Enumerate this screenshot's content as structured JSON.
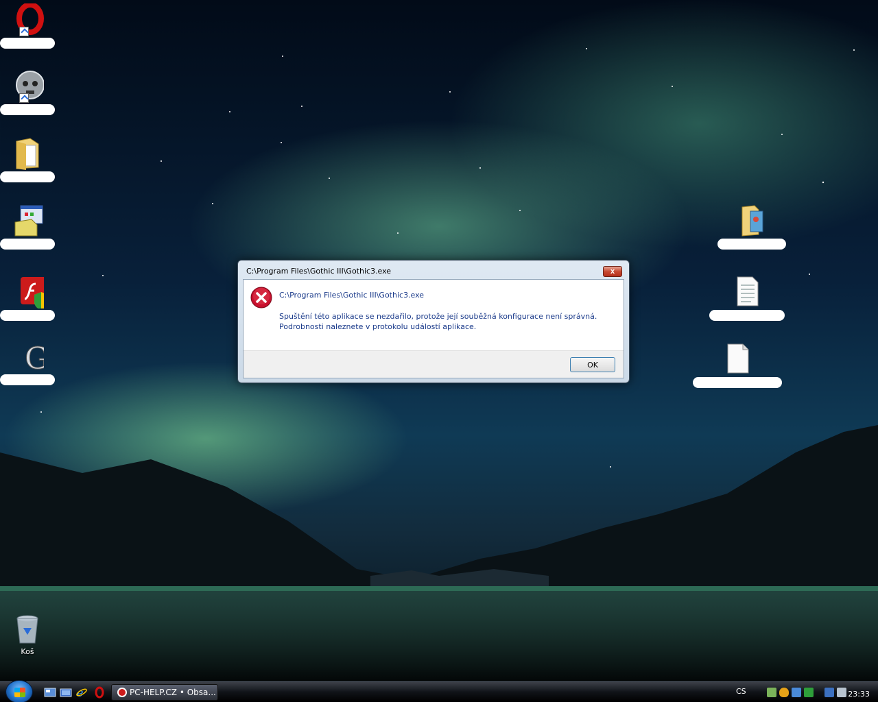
{
  "desktop": {
    "left_icons": [
      {
        "name": "opera-shortcut-icon",
        "label": ""
      },
      {
        "name": "skull-shortcut-icon",
        "label": ""
      },
      {
        "name": "folder-icon",
        "label": ""
      },
      {
        "name": "setup-program-icon",
        "label": ""
      },
      {
        "name": "flash-installer-icon",
        "label": ""
      },
      {
        "name": "gothic-game-icon",
        "label": ""
      }
    ],
    "recycle_bin": {
      "label": "Koš"
    },
    "right_icons": [
      {
        "name": "pictures-folder-icon",
        "label": ""
      },
      {
        "name": "text-document-icon",
        "label": ""
      },
      {
        "name": "blank-file-icon",
        "label": ""
      }
    ]
  },
  "dialog": {
    "title": "C:\\Program Files\\Gothic III\\Gothic3.exe",
    "close_label": "x",
    "heading": "C:\\Program Files\\Gothic III\\Gothic3.exe",
    "message_line1": "Spuštění této aplikace se nezdařilo, protože její souběžná konfigurace není správná.",
    "message_line2": "Podrobnosti naleznete v protokolu událostí aplikace.",
    "ok_label": "OK"
  },
  "taskbar": {
    "task_label": "PC-HELP.CZ • Obsa...",
    "language": "CS",
    "clock": "23:33"
  }
}
